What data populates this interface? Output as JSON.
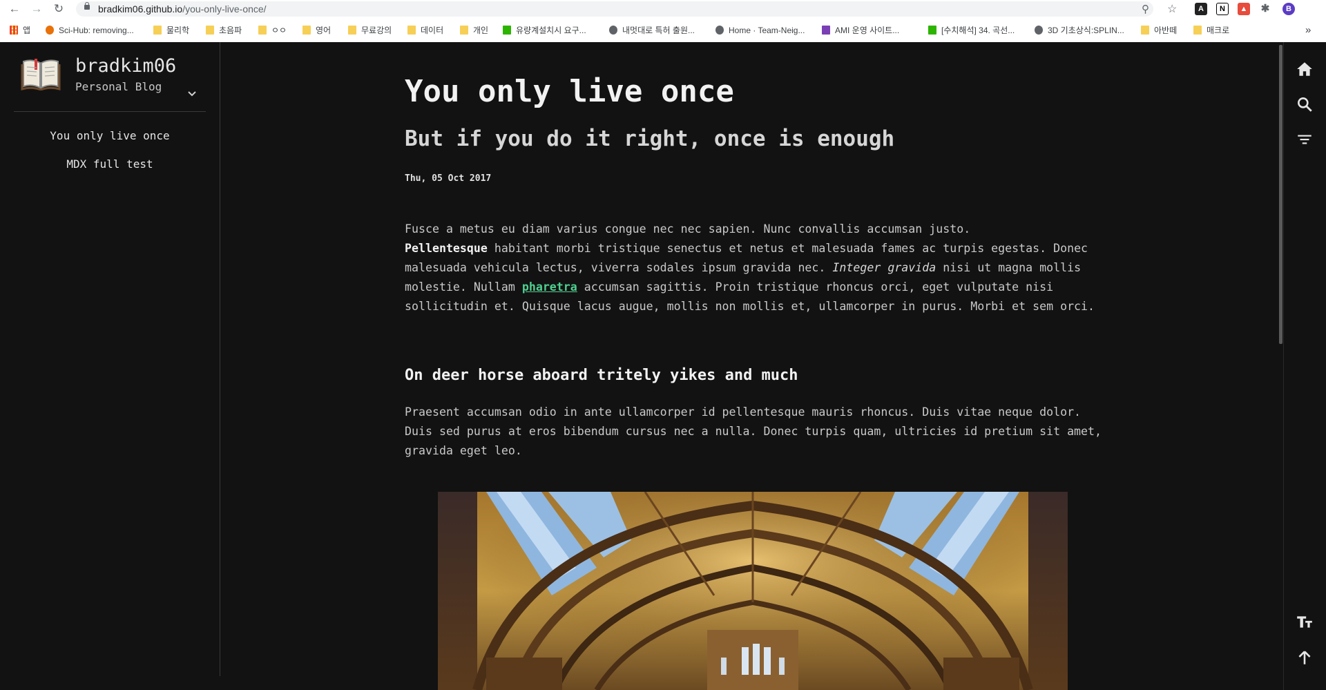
{
  "browser": {
    "url_host": "bradkim06.github.io",
    "url_path": "/you-only-live-once/",
    "profile_initial": "B",
    "bookmarks": [
      "앱",
      "Sci-Hub: removing...",
      "물리학",
      "초음파",
      "ㅇㅇ",
      "영어",
      "무료강의",
      "데이터",
      "개인",
      "유량계설치시 요구...",
      "내멋대로 특허 출원...",
      "Home · Team-Neig...",
      "AMI 운영 사이트...",
      "[수치해석] 34. 곡선...",
      "3D 기초상식:SPLIN...",
      "아반떼",
      "매크로"
    ],
    "more_bookmarks": "»"
  },
  "sidebar": {
    "site_title": "bradkim06",
    "site_subtitle": "Personal Blog",
    "nav": [
      "You only live once",
      "MDX full test"
    ]
  },
  "post": {
    "title": "You only live once",
    "subtitle": "But if you do it right, once is enough",
    "date": "Thu, 05 Oct 2017",
    "p1": {
      "text1": "Fusce a metus eu diam varius congue nec nec sapien. Nunc convallis accumsan justo.",
      "bold": "Pellentesque",
      "text2": " habitant morbi tristique senectus et netus et malesuada fames ac turpis egestas. Donec malesuada vehicula lectus, viverra sodales ipsum gravida nec. ",
      "italic": "Integer gravida",
      "text3": " nisi ut magna mollis molestie. Nullam ",
      "link": "pharetra",
      "text4": " accumsan sagittis. Proin tristique rhoncus orci, eget vulputate nisi sollicitudin et. Quisque lacus augue, mollis non mollis et, ullamcorper in purus. Morbi et sem orci."
    },
    "heading": "On deer horse aboard tritely yikes and much",
    "p2": "Praesent accumsan odio in ante ullamcorper id pellentesque mauris rhoncus. Duis vitae neque dolor. Duis sed purus at eros bibendum cursus nec a nulla. Donec turpis quam, ultricies id pretium sit amet, gravida eget leo."
  },
  "colors": {
    "background": "#121212",
    "text": "#c9c9c9",
    "link": "#4fcf91"
  }
}
